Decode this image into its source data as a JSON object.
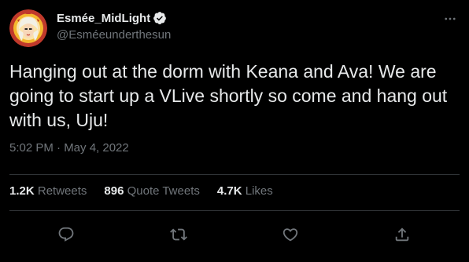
{
  "tweet": {
    "display_name": "Esmée_MidLight",
    "handle": "@Esméeunderthesun",
    "text": "Hanging out at the dorm with Keana and Ava! We are going to start up a VLive shortly so come and hang out with us, Uju!",
    "timestamp": "5:02 PM · May 4, 2022",
    "stats": {
      "retweets_count": "1.2K",
      "retweets_label": "Retweets",
      "quotes_count": "896",
      "quotes_label": "Quote Tweets",
      "likes_count": "4.7K",
      "likes_label": "Likes"
    },
    "verified": true
  },
  "icons": {
    "more": "more-dots-icon",
    "reply": "reply-icon",
    "retweet": "retweet-icon",
    "like": "heart-icon",
    "share": "share-icon",
    "verified": "verified-badge-icon"
  },
  "colors": {
    "background": "#000000",
    "text_primary": "#e7e9ea",
    "text_secondary": "#71767b",
    "divider": "#2f3336",
    "avatar_border": "#c0392b",
    "avatar_bg": "#f5b82e"
  }
}
